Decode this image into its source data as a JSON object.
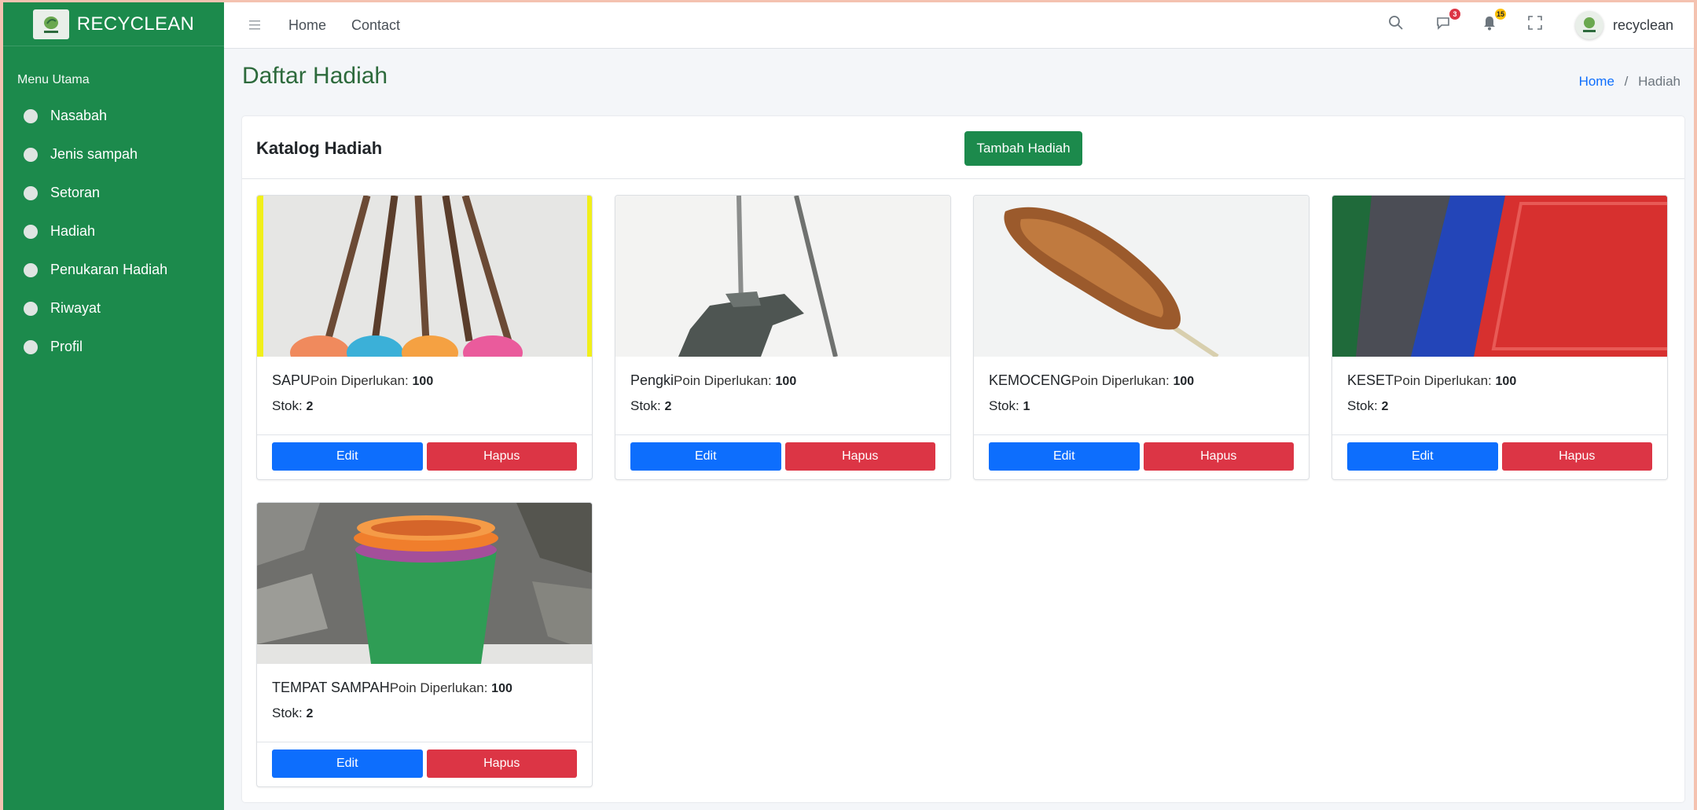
{
  "brand": {
    "name": "RECYCLEAN",
    "logo_icon": "recyclean-logo-icon"
  },
  "sidebar": {
    "header": "Menu Utama",
    "items": [
      {
        "label": "Nasabah"
      },
      {
        "label": "Jenis sampah"
      },
      {
        "label": "Setoran"
      },
      {
        "label": "Hadiah"
      },
      {
        "label": "Penukaran Hadiah"
      },
      {
        "label": "Riwayat"
      },
      {
        "label": "Profil"
      }
    ]
  },
  "topbar": {
    "menu_icon": "hamburger-icon",
    "links": [
      {
        "label": "Home"
      },
      {
        "label": "Contact"
      }
    ],
    "messages_count": "3",
    "notifications_count": "15",
    "username": "recyclean",
    "colors": {
      "messages_badge": "#dc3545",
      "notifications_badge": "#ffc107"
    }
  },
  "page": {
    "title": "Daftar Hadiah",
    "breadcrumb": {
      "home": "Home",
      "sep": "/",
      "current": "Hadiah"
    }
  },
  "catalog": {
    "title": "Katalog Hadiah",
    "add_button": "Tambah Hadiah",
    "points_label": "Poin Diperlukan:",
    "stock_label": "Stok:",
    "edit_label": "Edit",
    "delete_label": "Hapus",
    "items": [
      {
        "name": "SAPU",
        "points": "100",
        "stock": "2",
        "image": "broom-photo"
      },
      {
        "name": "Pengki",
        "points": "100",
        "stock": "2",
        "image": "dustpan-photo"
      },
      {
        "name": "KEMOCENG",
        "points": "100",
        "stock": "1",
        "image": "feather-duster-photo"
      },
      {
        "name": "KESET",
        "points": "100",
        "stock": "2",
        "image": "doormat-photo"
      },
      {
        "name": "TEMPAT SAMPAH",
        "points": "100",
        "stock": "2",
        "image": "trash-bin-photo"
      }
    ]
  },
  "colors": {
    "primary_green": "#1c8a4c",
    "title_green": "#2d6a3c",
    "edit_blue": "#0d6efd",
    "delete_red": "#dc3545"
  }
}
